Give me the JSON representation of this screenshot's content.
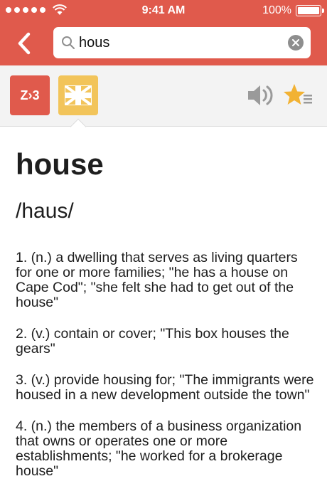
{
  "status_bar": {
    "time": "9:41 AM",
    "battery_percent": "100%",
    "signal_dots": 5
  },
  "search": {
    "query": "hous",
    "placeholder": ""
  },
  "toolbar": {
    "lang_zh_label": "Z›3",
    "lang_en_icon": "uk-flag-icon",
    "speaker_icon": "speaker-icon",
    "favorite_icon": "star-list-icon"
  },
  "entry": {
    "headword": "house",
    "phonetic": "/haus/",
    "definitions": [
      "1. (n.) a dwelling that serves as living quarters for one or more families; \"he has a house on Cape Cod\"; \"she felt she had to get out of the house\"",
      "2. (v.) contain or cover; \"This box houses the gears\"",
      "3. (v.) provide housing for; \"The immigrants were housed in a new development outside the town\"",
      "4. (n.) the members of a business organization that owns or operates one or more establishments; \"he worked for a brokerage house\""
    ]
  },
  "colors": {
    "accent": "#e05a4c",
    "flag_button": "#f2c45a",
    "star": "#f2b233",
    "icon_gray": "#9a9a9a"
  }
}
